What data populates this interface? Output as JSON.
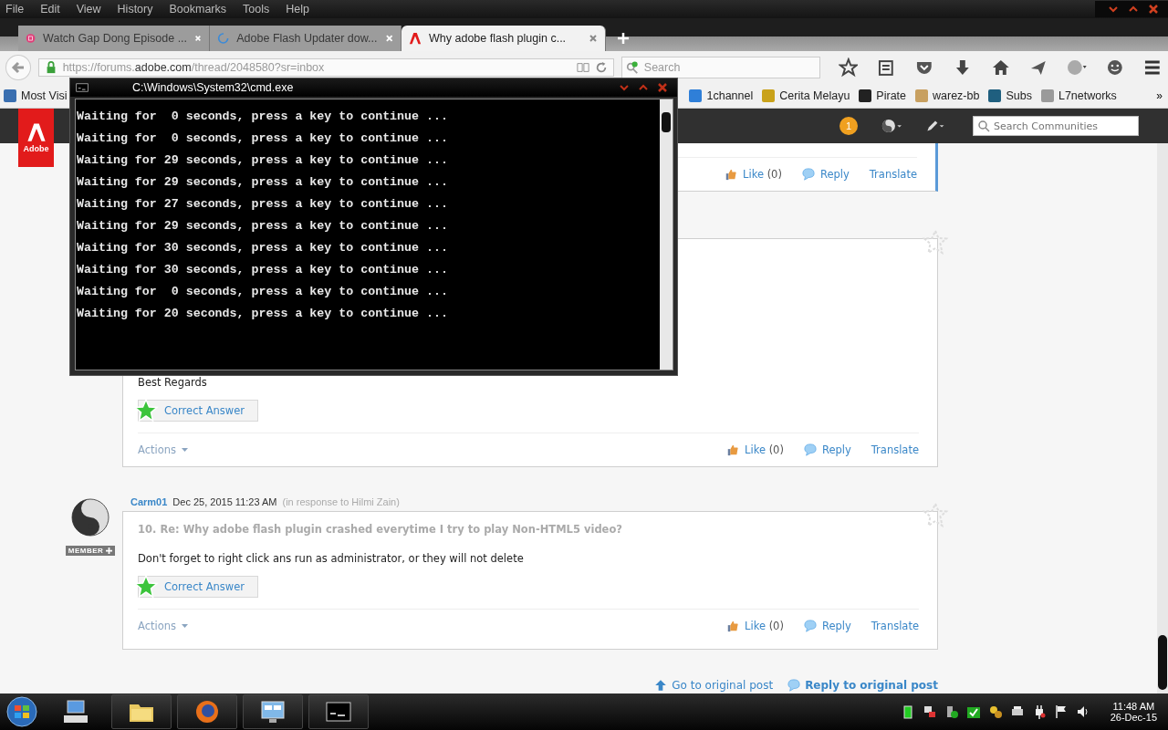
{
  "menu_bar": [
    "File",
    "Edit",
    "View",
    "History",
    "Bookmarks",
    "Tools",
    "Help"
  ],
  "tabs": [
    {
      "title": "Watch Gap Dong Episode ...",
      "selected": false
    },
    {
      "title": "Adobe Flash Updater dow...",
      "selected": false
    },
    {
      "title": "Why adobe flash plugin c...",
      "selected": true
    }
  ],
  "address_bar": {
    "url_prefix": "https://forums.",
    "url_domain": "adobe.com",
    "url_path": "/thread/2048580?sr=inbox"
  },
  "search": {
    "placeholder": "Search"
  },
  "bookmarks": [
    {
      "label": "Most Visi",
      "color": "#3a6fb0"
    },
    {
      "label": "1channel",
      "color": "#2f7fd8"
    },
    {
      "label": "Cerita Melayu",
      "color": "#c9a21a"
    },
    {
      "label": "Pirate",
      "color": "#222222"
    },
    {
      "label": "warez-bb",
      "color": "#c8a060"
    },
    {
      "label": "Subs",
      "color": "#1f5f7f"
    },
    {
      "label": "L7networks",
      "color": "#9a9a9a"
    }
  ],
  "bookmarks_overflow": "»",
  "site_header": {
    "logo": "Adobe",
    "notification_count": "1",
    "search_placeholder": "Search Communities"
  },
  "posts": [
    {
      "kind": "tail",
      "highlighted": true,
      "like": "Like",
      "like_count": "(0)",
      "reply": "Reply",
      "translate": "Translate"
    },
    {
      "kind": "covered",
      "highlighted": false,
      "body": "Best Regards",
      "correct_answer": "Correct Answer",
      "actions": "Actions",
      "like": "Like",
      "like_count": "(0)",
      "reply": "Reply",
      "translate": "Translate"
    },
    {
      "kind": "full",
      "highlighted": false,
      "author": "Carm01",
      "date": "Dec 25, 2015 11:23 AM",
      "in_response": "(in response to Hilmi Zain)",
      "rank": "MEMBER",
      "title": "10. Re: Why adobe flash plugin crashed everytime I try to play Non-HTML5 video?",
      "body": "Don't forget to right click ans run as administrator, or they will not delete",
      "correct_answer": "Correct Answer",
      "actions": "Actions",
      "like": "Like",
      "like_count": "(0)",
      "reply": "Reply",
      "translate": "Translate"
    }
  ],
  "footer_links": [
    "Go to original post",
    "Reply to original post"
  ],
  "cmd_window": {
    "title": "C:\\Windows\\System32\\cmd.exe",
    "lines": [
      "Waiting for  0 seconds, press a key to continue ...",
      "Waiting for  0 seconds, press a key to continue ...",
      "Waiting for 29 seconds, press a key to continue ...",
      "Waiting for 29 seconds, press a key to continue ...",
      "Waiting for 27 seconds, press a key to continue ...",
      "Waiting for 29 seconds, press a key to continue ...",
      "Waiting for 30 seconds, press a key to continue ...",
      "Waiting for 30 seconds, press a key to continue ...",
      "Waiting for  0 seconds, press a key to continue ...",
      "Waiting for 20 seconds, press a key to continue ..."
    ]
  },
  "taskbar": {
    "time": "11:48 AM",
    "date": "26-Dec-15"
  }
}
